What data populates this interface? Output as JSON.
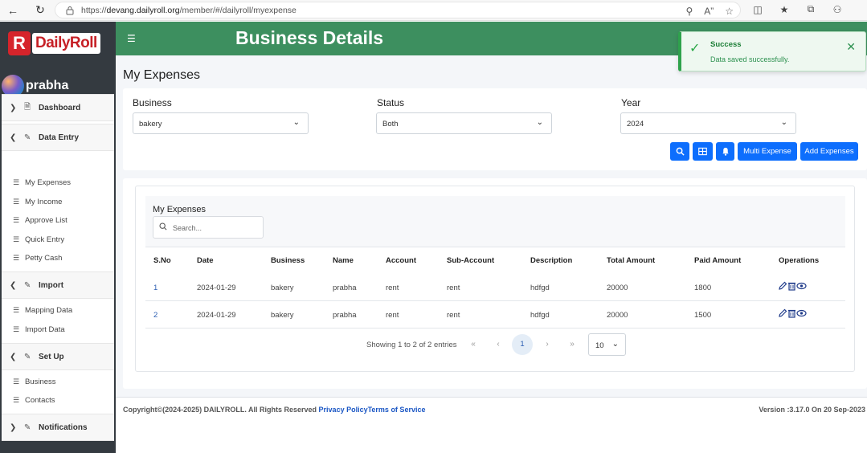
{
  "browser": {
    "url_prefix": "https://",
    "url_host": "devang.dailyroll.org",
    "url_path": "/member/#/dailyroll/myexpense"
  },
  "sidebar": {
    "logo_letter": "R",
    "logo_text": "DailyRoll",
    "user_name": "prabha",
    "sections": [
      {
        "label": "Dashboard",
        "expanded": false,
        "items": []
      },
      {
        "label": "Data Entry",
        "expanded": true,
        "items": [
          "My Expenses",
          "My Income",
          "Approve List",
          "Quick Entry",
          "Petty Cash"
        ]
      },
      {
        "label": "Import",
        "expanded": true,
        "items": [
          "Mapping Data",
          "Import Data"
        ]
      },
      {
        "label": "Set Up",
        "expanded": true,
        "items": [
          "Business",
          "Contacts"
        ]
      },
      {
        "label": "Notifications",
        "expanded": false,
        "items": []
      }
    ]
  },
  "header": {
    "title": "Business Details"
  },
  "toast": {
    "title": "Success",
    "message": "Data saved successfully."
  },
  "page": {
    "title": "My Expenses"
  },
  "filters": {
    "business": {
      "label": "Business",
      "value": "bakery"
    },
    "status": {
      "label": "Status",
      "value": "Both"
    },
    "year": {
      "label": "Year",
      "value": "2024"
    }
  },
  "buttons": {
    "multi_expense": "Multi Expense",
    "add_expenses": "Add Expenses"
  },
  "table": {
    "title": "My Expenses",
    "search_placeholder": "Search...",
    "columns": [
      "S.No",
      "Date",
      "Business",
      "Name",
      "Account",
      "Sub-Account",
      "Description",
      "Total Amount",
      "Paid Amount",
      "Operations"
    ],
    "rows": [
      [
        "1",
        "2024-01-29",
        "bakery",
        "prabha",
        "rent",
        "rent",
        "hdfgd",
        "20000",
        "1800"
      ],
      [
        "2",
        "2024-01-29",
        "bakery",
        "prabha",
        "rent",
        "rent",
        "hdfgd",
        "20000",
        "1500"
      ]
    ]
  },
  "pagination": {
    "info": "Showing 1 to 2 of 2 entries",
    "current_page": "1",
    "page_size": "10"
  },
  "footer": {
    "copyright": "Copyright©(2024-2025) DAILYROLL. All Rights Reserved",
    "privacy": "Privacy Policy",
    "terms": "Terms of Service",
    "version": "Version :3.17.0 On 20 Sep-2023"
  }
}
